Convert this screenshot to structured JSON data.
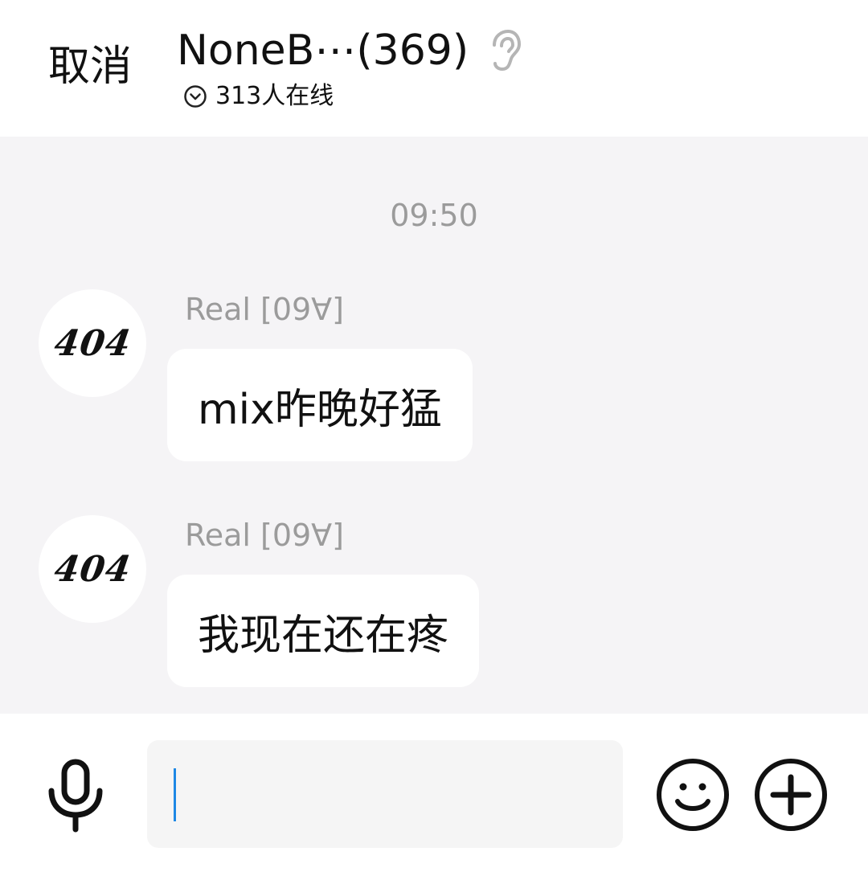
{
  "header": {
    "cancel_label": "取消",
    "title": "NoneB⋯(369)",
    "online_text": "313人在线"
  },
  "chat": {
    "timestamp": "09:50",
    "messages": [
      {
        "avatar_text": "404",
        "sender": "Real [09∀]",
        "text": "mix昨晚好猛"
      },
      {
        "avatar_text": "404",
        "sender": "Real [09∀]",
        "text": "我现在还在疼"
      }
    ]
  },
  "input_bar": {
    "value": "",
    "icons": [
      "microphone-icon",
      "emoji-icon",
      "plus-icon"
    ]
  },
  "colors": {
    "chat_background": "#f5f4f6",
    "muted_text": "#9b9b9b",
    "caret": "#1e88e5"
  }
}
